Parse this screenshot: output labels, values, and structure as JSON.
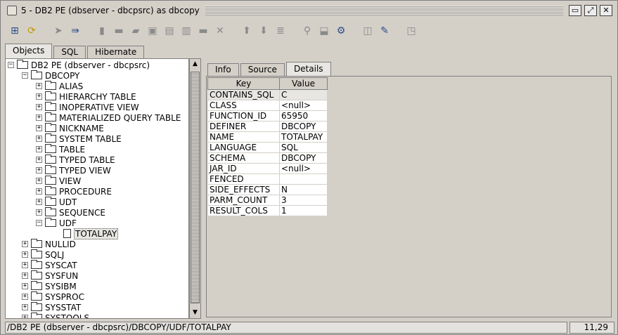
{
  "window": {
    "title": "5 - DB2 PE (dbserver - dbcpsrc)  as dbcopy"
  },
  "left_tabs": [
    {
      "label": "Objects"
    },
    {
      "label": "SQL"
    },
    {
      "label": "Hibernate"
    }
  ],
  "tree": {
    "root": "DB2 PE (dbserver - dbcpsrc)",
    "schema": "DBCOPY",
    "schema_children": [
      "ALIAS",
      "HIERARCHY TABLE",
      "INOPERATIVE VIEW",
      "MATERIALIZED QUERY TABLE",
      "NICKNAME",
      "SYSTEM TABLE",
      "TABLE",
      "TYPED TABLE",
      "TYPED VIEW",
      "VIEW",
      "PROCEDURE",
      "UDT",
      "SEQUENCE",
      "UDF"
    ],
    "udf_child": "TOTALPAY",
    "other_schemas": [
      "NULLID",
      "SQLJ",
      "SYSCAT",
      "SYSFUN",
      "SYSIBM",
      "SYSPROC",
      "SYSSTAT",
      "SYSTOOLS"
    ]
  },
  "right_tabs": [
    {
      "label": "Info"
    },
    {
      "label": "Source"
    },
    {
      "label": "Details"
    }
  ],
  "details": {
    "headers": {
      "key": "Key",
      "value": "Value"
    },
    "rows": [
      {
        "key": "CONTAINS_SQL",
        "value": "C"
      },
      {
        "key": "CLASS",
        "value": "<null>"
      },
      {
        "key": "FUNCTION_ID",
        "value": "65950"
      },
      {
        "key": "DEFINER",
        "value": "DBCOPY"
      },
      {
        "key": "NAME",
        "value": "TOTALPAY"
      },
      {
        "key": "LANGUAGE",
        "value": "SQL"
      },
      {
        "key": "SCHEMA",
        "value": "DBCOPY"
      },
      {
        "key": "JAR_ID",
        "value": "<null>"
      },
      {
        "key": "FENCED",
        "value": ""
      },
      {
        "key": "SIDE_EFFECTS",
        "value": "N"
      },
      {
        "key": "PARM_COUNT",
        "value": "3"
      },
      {
        "key": "RESULT_COLS",
        "value": "1"
      }
    ]
  },
  "status": {
    "path": "/DB2 PE (dbserver - dbcpsrc)/DBCOPY/UDF/TOTALPAY",
    "position": "11,29"
  }
}
